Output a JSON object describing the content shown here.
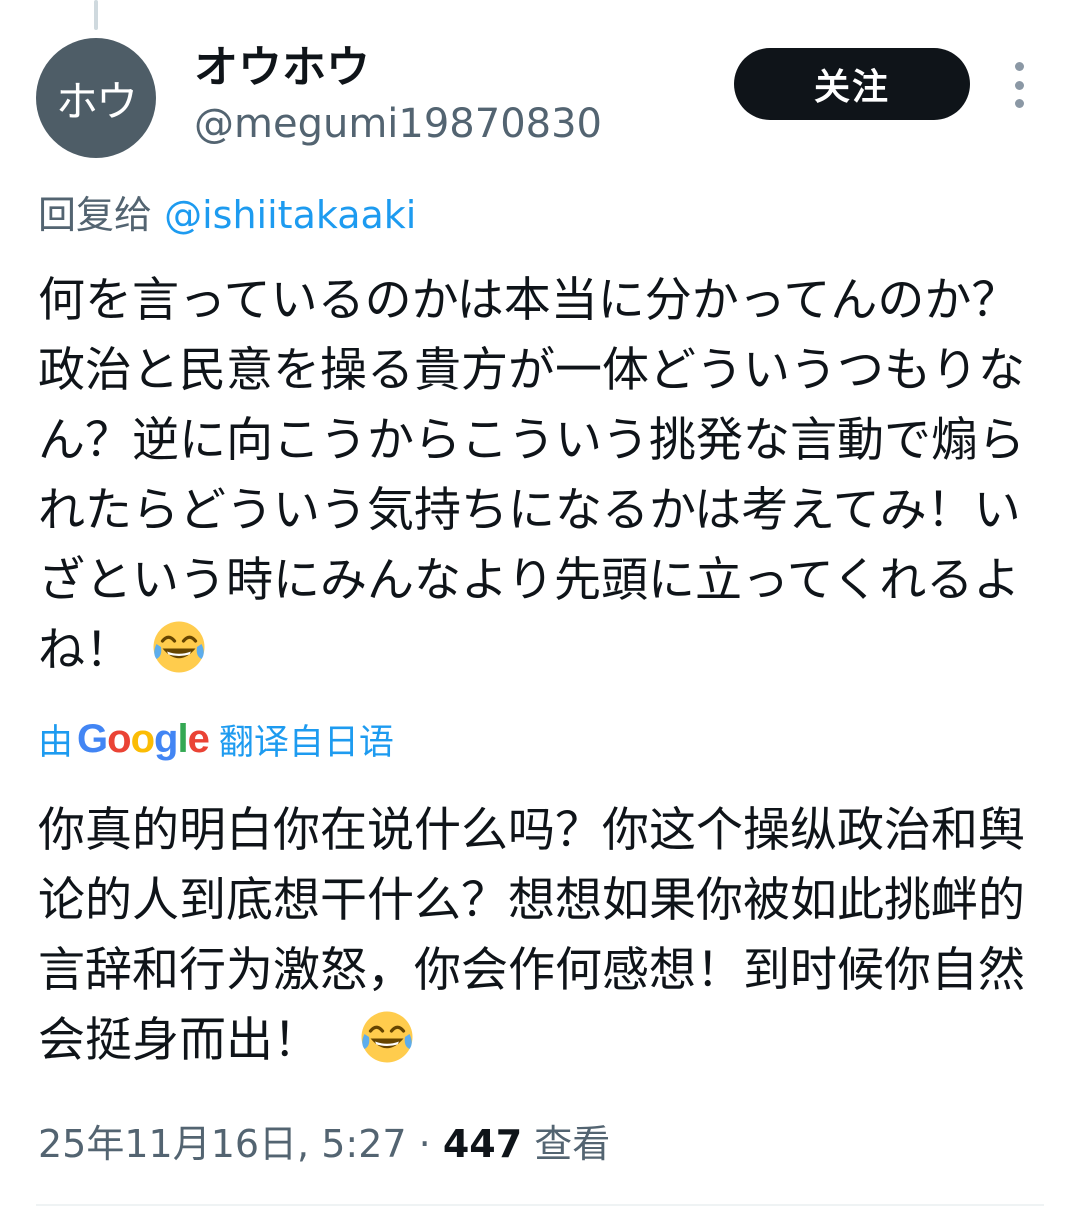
{
  "tweet": {
    "author": {
      "avatar_text": "ホウ",
      "display_name": "オウホウ",
      "handle": "@megumi19870830"
    },
    "follow_label": "关注",
    "more_icon": "more-vertical-icon",
    "reply_prefix": "回复给",
    "reply_mention": "@ishiitakaaki",
    "text_original": "何を言っているのかは本当に分かってんのか？政治と民意を操る貴方が一体どういうつもりなん？逆に向こうからこういう挑発な言動で煽られたらどういう気持ちになるかは考えてみ！いざという時にみんなより先頭に立ってくれるよね！",
    "emoji_icon": "face-with-tears-of-joy-icon",
    "translate_prefix": "由",
    "translate_brand": "Google",
    "translate_suffix": "翻译自日语",
    "text_translated": "你真的明白你在说什么吗？你这个操纵政治和舆论的人到底想干什么？想想如果你被如此挑衅的言辞和行为激怒，你会作何感想！到时候你自然会挺身而出！",
    "timestamp": "25年11月16日, 5:27",
    "separator": " · ",
    "view_count": "447",
    "view_label": "查看"
  },
  "colors": {
    "text_primary": "#0f1419",
    "text_secondary": "#536471",
    "link": "#1d9bf0",
    "button_bg": "#0f1419",
    "avatar_bg": "#4e5d67",
    "emoji_face": "#ffcc4d"
  }
}
